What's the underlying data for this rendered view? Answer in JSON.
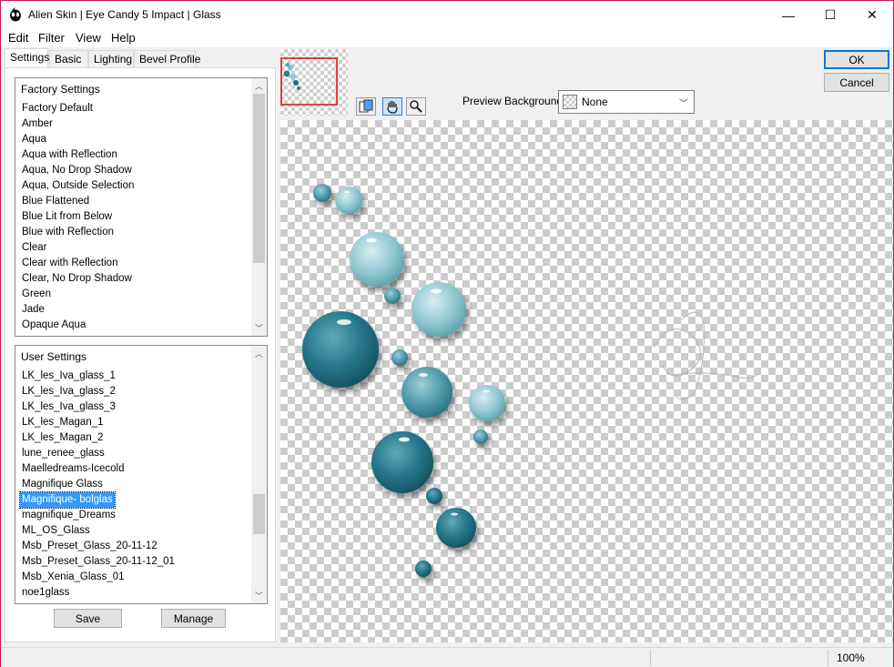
{
  "window": {
    "title": "Alien Skin | Eye Candy 5 Impact | Glass",
    "minimize_glyph": "—",
    "maximize_glyph": "☐",
    "close_glyph": "✕"
  },
  "menu": [
    "Edit",
    "Filter",
    "View",
    "Help"
  ],
  "tabs": [
    "Settings",
    "Basic",
    "Lighting",
    "Bevel Profile"
  ],
  "factory_settings": {
    "header": "Factory Settings",
    "items": [
      "Factory Default",
      "Amber",
      "Aqua",
      "Aqua with Reflection",
      "Aqua, No Drop Shadow",
      "Aqua, Outside Selection",
      "Blue Flattened",
      "Blue Lit from Below",
      "Blue with Reflection",
      "Clear",
      "Clear with Reflection",
      "Clear, No Drop Shadow",
      "Green",
      "Jade",
      "Opaque Aqua"
    ]
  },
  "user_settings": {
    "header": "User Settings",
    "items": [
      "LK_les_Iva_glass_1",
      "LK_les_Iva_glass_2",
      "LK_les_Iva_glass_3",
      "LK_les_Magan_1",
      "LK_les_Magan_2",
      "lune_renee_glass",
      "Maelledreams-Icecold",
      "Magnifique Glass",
      "Magnifique- bolglas",
      "magnifique_Dreams",
      "ML_OS_Glass",
      "Msb_Preset_Glass_20-11-12",
      "Msb_Preset_Glass_20-11-12_01",
      "Msb_Xenia_Glass_01",
      "noe1glass"
    ],
    "selected": "Magnifique- bolglas"
  },
  "buttons": {
    "save": "Save",
    "manage": "Manage",
    "ok": "OK",
    "cancel": "Cancel"
  },
  "preview_background": {
    "label": "Preview Background:",
    "value": "None"
  },
  "status": {
    "zoom": "100%"
  },
  "colors": {
    "selection": "#3399ff",
    "accent_border": "#c2185b",
    "thumb_frame": "#e04040"
  }
}
